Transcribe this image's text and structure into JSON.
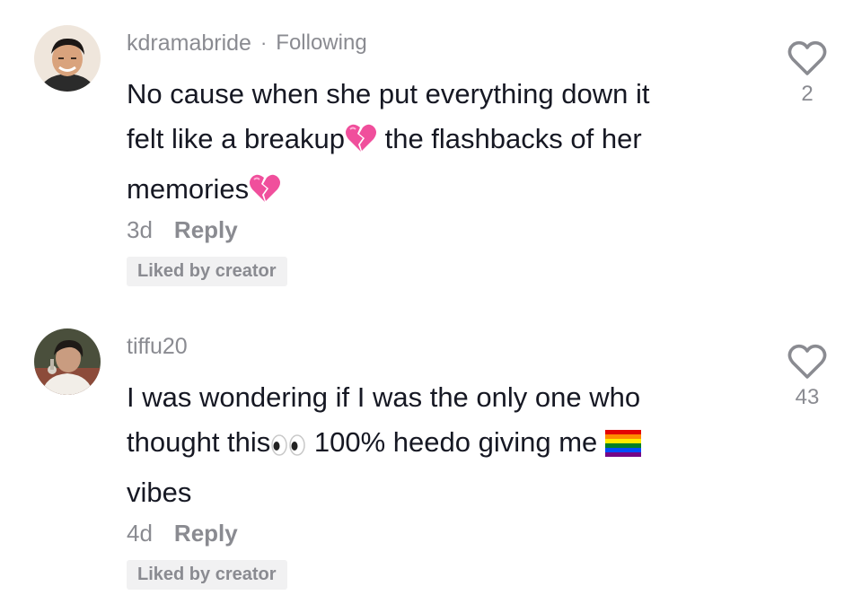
{
  "comments": [
    {
      "username": "kdramabride",
      "separator": "·",
      "following_label": "Following",
      "text_lines": [
        "No cause when she put everything down it",
        "felt like a breakup",
        " the flashbacks of her",
        "memories"
      ],
      "age": "3d",
      "reply_label": "Reply",
      "badge": "Liked by creator",
      "like_count": "2",
      "avatar_icon": "avatar-photo",
      "emojis": [
        "broken-heart-icon",
        "broken-heart-icon"
      ]
    },
    {
      "username": "tiffu20",
      "text_lines": [
        "I was wondering if I was the only one who",
        "thought this",
        " 100% heedo giving me ",
        "vibes"
      ],
      "age": "4d",
      "reply_label": "Reply",
      "badge": "Liked by creator",
      "like_count": "43",
      "avatar_icon": "avatar-photo",
      "emojis": [
        "eyes-icon",
        "rainbow-flag-icon"
      ]
    }
  ],
  "colors": {
    "secondary_text": "#8a8b91",
    "primary_text": "#161823",
    "badge_bg": "#f1f1f2",
    "broken_heart": "#f04f9c"
  }
}
